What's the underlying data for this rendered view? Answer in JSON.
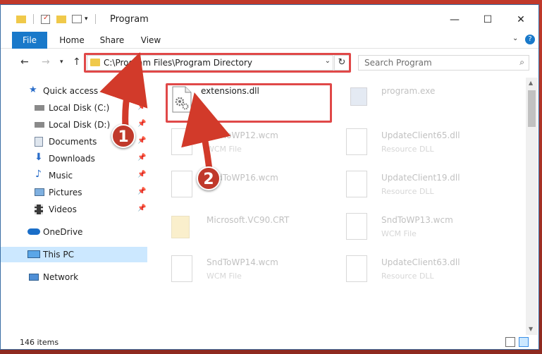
{
  "window": {
    "title": "Program",
    "controls": {
      "minimize": "—",
      "maximize": "☐",
      "close": "✕"
    }
  },
  "ribbon": {
    "tabs": [
      {
        "label": "File",
        "active": true
      },
      {
        "label": "Home"
      },
      {
        "label": "Share"
      },
      {
        "label": "View"
      }
    ],
    "expand_icon": "chevron-down-icon",
    "help_icon": "help-icon"
  },
  "address": {
    "path": "C:\\Program Files\\Program Directory",
    "search_placeholder": "Search Program"
  },
  "navigation": {
    "items": [
      {
        "label": "Quick access",
        "icon": "star-icon",
        "pinned": false
      },
      {
        "label": "Local Disk (C:)",
        "icon": "drive-icon",
        "pinned": true
      },
      {
        "label": "Local Disk (D:)",
        "icon": "drive-icon",
        "pinned": true
      },
      {
        "label": "Documents",
        "icon": "documents-icon",
        "pinned": true
      },
      {
        "label": "Downloads",
        "icon": "download-icon",
        "pinned": true
      },
      {
        "label": "Music",
        "icon": "music-icon",
        "pinned": true
      },
      {
        "label": "Pictures",
        "icon": "pictures-icon",
        "pinned": true
      },
      {
        "label": "Videos",
        "icon": "videos-icon",
        "pinned": true
      },
      {
        "label": "OneDrive",
        "icon": "cloud-icon",
        "pinned": false
      },
      {
        "label": "This PC",
        "icon": "computer-icon",
        "pinned": false,
        "selected": true
      },
      {
        "label": "Network",
        "icon": "network-icon",
        "pinned": false
      }
    ]
  },
  "files": [
    {
      "name": "extensions.dll",
      "type": "",
      "faded": false,
      "icon": "dll-gear-icon"
    },
    {
      "name": "program.exe",
      "type": "",
      "faded": true,
      "icon": "exe-icon"
    },
    {
      "name": "SndToWP12.wcm",
      "type": "WCM File",
      "faded": true,
      "icon": "blank-file-icon"
    },
    {
      "name": "UpdateClient65.dll",
      "type": "Resource DLL",
      "faded": true,
      "icon": "blank-file-icon"
    },
    {
      "name": "SndToWP16.wcm",
      "type": "",
      "faded": true,
      "icon": "blank-file-icon"
    },
    {
      "name": "UpdateClient19.dll",
      "type": "Resource DLL",
      "faded": true,
      "icon": "blank-file-icon"
    },
    {
      "name": "Microsoft.VC90.CRT",
      "type": "",
      "faded": true,
      "icon": "folder-icon"
    },
    {
      "name": "SndToWP13.wcm",
      "type": "WCM File",
      "faded": true,
      "icon": "blank-file-icon"
    },
    {
      "name": "SndToWP14.wcm",
      "type": "WCM File",
      "faded": true,
      "icon": "blank-file-icon"
    },
    {
      "name": "UpdateClient63.dll",
      "type": "Resource DLL",
      "faded": true,
      "icon": "blank-file-icon"
    }
  ],
  "status": {
    "item_count": "146 items"
  },
  "annotations": {
    "step1": "1",
    "step2": "2"
  },
  "colors": {
    "accent": "#1979ca",
    "highlight": "#e04848",
    "selected": "#cce8ff",
    "badge": "#c0392b"
  }
}
